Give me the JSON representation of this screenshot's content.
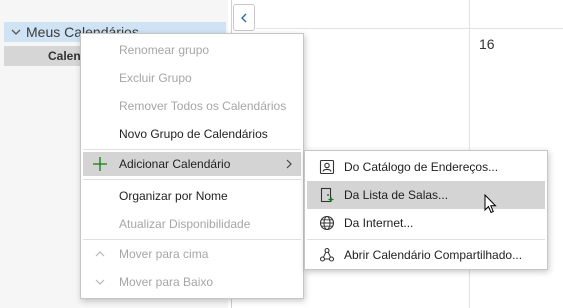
{
  "nav": {
    "group_label": "Meus Calendários",
    "calendar_label": "Calen"
  },
  "calendar": {
    "day_number": "16"
  },
  "context_menu": {
    "items": [
      {
        "label": "Renomear grupo",
        "enabled": false
      },
      {
        "label": "Excluir Grupo",
        "enabled": false
      },
      {
        "label": "Remover Todos os Calendários",
        "enabled": false
      },
      {
        "label": "Novo Grupo de Calendários",
        "enabled": true
      },
      {
        "label": "Adicionar Calendário",
        "enabled": true,
        "icon": "plus-icon",
        "submenu": true,
        "highlighted": true
      },
      {
        "label": "Organizar por Nome",
        "enabled": true
      },
      {
        "label": "Atualizar Disponibilidade",
        "enabled": false
      },
      {
        "label": "Mover para cima",
        "enabled": false,
        "icon": "chevron-up-icon"
      },
      {
        "label": "Mover para Baixo",
        "enabled": false,
        "icon": "chevron-down-icon"
      }
    ]
  },
  "submenu": {
    "items": [
      {
        "label": "Do Catálogo de Endereços...",
        "icon": "address-book-icon"
      },
      {
        "label": "Da Lista de Salas...",
        "icon": "room-list-icon",
        "highlighted": true
      },
      {
        "label": "Da Internet...",
        "icon": "globe-icon"
      },
      {
        "label": "Abrir Calendário Compartilhado...",
        "icon": "share-icon"
      }
    ]
  },
  "colors": {
    "nav_selected": "#cfe3f4",
    "accent_green": "#107c10",
    "menu_highlight": "#d4d4d4",
    "disabled_text": "#a6a6a6"
  }
}
